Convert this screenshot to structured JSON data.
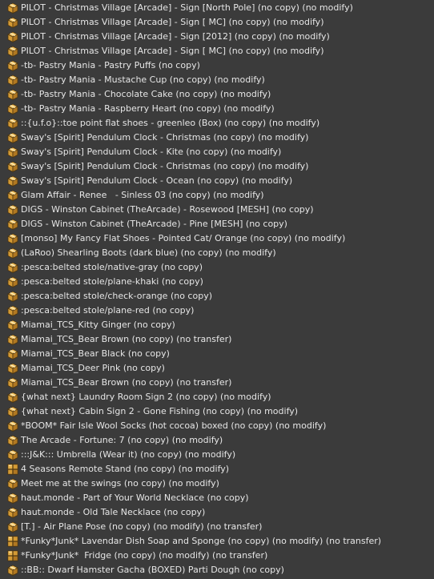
{
  "inventory": {
    "items": [
      {
        "label": "PILOT - Christmas Village [Arcade] - Sign [North Pole] (no copy) (no modify)",
        "icon": "object-box-icon"
      },
      {
        "label": "PILOT - Christmas Village [Arcade] - Sign [ MC] (no copy) (no modify)",
        "icon": "object-box-icon"
      },
      {
        "label": "PILOT - Christmas Village [Arcade] - Sign [2012] (no copy) (no modify)",
        "icon": "object-box-icon"
      },
      {
        "label": "PILOT - Christmas Village [Arcade] - Sign [ MC] (no copy) (no modify)",
        "icon": "object-box-icon"
      },
      {
        "label": "-tb- Pastry Mania - Pastry Puffs (no copy)",
        "icon": "object-box-icon"
      },
      {
        "label": "-tb- Pastry Mania - Mustache Cup (no copy) (no modify)",
        "icon": "object-box-icon"
      },
      {
        "label": "-tb- Pastry Mania - Chocolate Cake (no copy) (no modify)",
        "icon": "object-box-icon"
      },
      {
        "label": "-tb- Pastry Mania - Raspberry Heart (no copy) (no modify)",
        "icon": "object-box-icon"
      },
      {
        "label": "::{u.f.o}::toe point flat shoes - greenleo (Box) (no copy) (no modify)",
        "icon": "object-box-icon"
      },
      {
        "label": "Sway's [Spirit] Pendulum Clock - Christmas (no copy) (no modify)",
        "icon": "object-box-icon"
      },
      {
        "label": "Sway's [Spirit] Pendulum Clock - Kite (no copy) (no modify)",
        "icon": "object-box-icon"
      },
      {
        "label": "Sway's [Spirit] Pendulum Clock - Christmas (no copy) (no modify)",
        "icon": "object-box-icon"
      },
      {
        "label": "Sway's [Spirit] Pendulum Clock - Ocean (no copy) (no modify)",
        "icon": "object-box-icon"
      },
      {
        "label": "Glam Affair - Renee   - Sinless 03 (no copy) (no modify)",
        "icon": "object-box-icon"
      },
      {
        "label": "DIGS - Winston Cabinet (TheArcade) - Rosewood [MESH] (no copy)",
        "icon": "object-box-icon"
      },
      {
        "label": "DIGS - Winston Cabinet (TheArcade) - Pine [MESH] (no copy)",
        "icon": "object-box-icon"
      },
      {
        "label": "[monso] My Fancy Flat Shoes - Pointed Cat/ Orange (no copy) (no modify)",
        "icon": "object-box-icon"
      },
      {
        "label": "(LaRoo) Shearling Boots (dark blue) (no copy) (no modify)",
        "icon": "object-box-icon"
      },
      {
        "label": ":pesca:belted stole/native-gray (no copy)",
        "icon": "object-box-icon"
      },
      {
        "label": ":pesca:belted stole/plane-khaki (no copy)",
        "icon": "object-box-icon"
      },
      {
        "label": ":pesca:belted stole/check-orange (no copy)",
        "icon": "object-box-icon"
      },
      {
        "label": ":pesca:belted stole/plane-red (no copy)",
        "icon": "object-box-icon"
      },
      {
        "label": "Miamai_TCS_Kitty Ginger (no copy)",
        "icon": "object-box-icon"
      },
      {
        "label": "Miamai_TCS_Bear Brown (no copy) (no transfer)",
        "icon": "object-box-icon"
      },
      {
        "label": "Miamai_TCS_Bear Black (no copy)",
        "icon": "object-box-icon"
      },
      {
        "label": "Miamai_TCS_Deer Pink (no copy)",
        "icon": "object-box-icon"
      },
      {
        "label": "Miamai_TCS_Bear Brown (no copy) (no transfer)",
        "icon": "object-box-icon"
      },
      {
        "label": "{what next} Laundry Room Sign 2 (no copy) (no modify)",
        "icon": "object-box-icon"
      },
      {
        "label": "{what next} Cabin Sign 2 - Gone Fishing (no copy) (no modify)",
        "icon": "object-box-icon"
      },
      {
        "label": "*BOOM* Fair Isle Wool Socks (hot cocoa) boxed (no copy) (no modify)",
        "icon": "object-box-icon"
      },
      {
        "label": "The Arcade - Fortune: 7 (no copy) (no modify)",
        "icon": "object-box-icon"
      },
      {
        "label": ":::J&K::: Umbrella (Wear it) (no copy) (no modify)",
        "icon": "object-box-icon"
      },
      {
        "label": "4 Seasons Remote Stand (no copy) (no modify)",
        "icon": "object-boxes-icon"
      },
      {
        "label": "Meet me at the swings (no copy) (no modify)",
        "icon": "object-box-icon"
      },
      {
        "label": "haut.monde - Part of Your World Necklace (no copy)",
        "icon": "object-box-icon"
      },
      {
        "label": "haut.monde - Old Tale Necklace (no copy)",
        "icon": "object-box-icon"
      },
      {
        "label": "[T.] - Air Plane Pose (no copy) (no modify) (no transfer)",
        "icon": "object-box-icon"
      },
      {
        "label": "*Funky*Junk* Lavendar Dish Soap and Sponge (no copy) (no modify) (no transfer)",
        "icon": "object-boxes-icon"
      },
      {
        "label": "*Funky*Junk*  Fridge (no copy) (no modify) (no transfer)",
        "icon": "object-boxes-icon"
      },
      {
        "label": "::BB:: Dwarf Hamster Gacha (BOXED) Parti Dough (no copy)",
        "icon": "object-box-icon"
      }
    ]
  },
  "colors": {
    "background": "#3b3b3b",
    "text": "#e6e6e6",
    "box_top": "#f0c060",
    "box_left": "#d39a35",
    "box_right": "#b07822",
    "box_outline": "#4a3410"
  }
}
